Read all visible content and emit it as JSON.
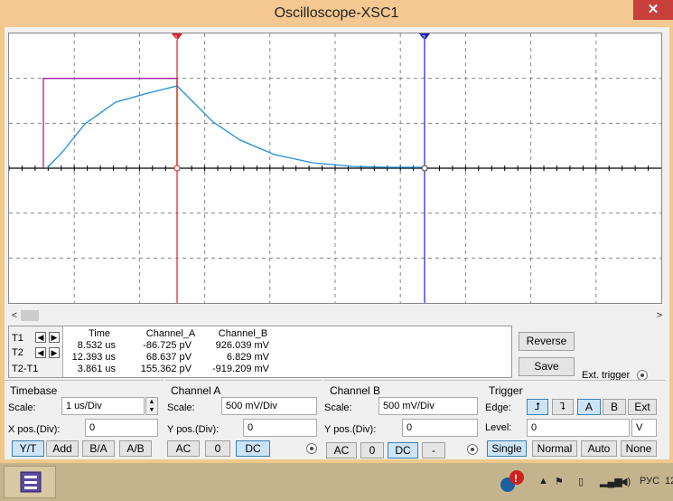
{
  "window": {
    "title": "Oscilloscope-XSC1",
    "close_glyph": "✕"
  },
  "screen": {
    "background": "#ffffff",
    "grid_color": "#888888",
    "channel_a_color": "#1f8fd6",
    "channel_b_color": "#a020a0",
    "cursor1_color": "#e02020",
    "cursor2_color": "#2020c0",
    "cursor1_label": "1",
    "cursor2_label": "2"
  },
  "readout": {
    "headers": [
      "Time",
      "Channel_A",
      "Channel_B"
    ],
    "rows": [
      {
        "label": "T1",
        "time": "8.532 us",
        "a": "-86.725 pV",
        "b": "926.039 mV"
      },
      {
        "label": "T2",
        "time": "12.393 us",
        "a": "68.637 pV",
        "b": "6.829 mV"
      },
      {
        "label": "T2-T1",
        "time": "3.861 us",
        "a": "155.362 pV",
        "b": "-919.209 mV"
      }
    ],
    "arrow_left": "◀",
    "arrow_right": "▶"
  },
  "side_buttons": {
    "reverse": "Reverse",
    "save": "Save",
    "ext_trigger": "Ext. trigger"
  },
  "timebase": {
    "title": "Timebase",
    "scale_label": "Scale:",
    "scale_value": "1 us/Div",
    "xpos_label": "X pos.(Div):",
    "xpos_value": "0",
    "modes": [
      "Y/T",
      "Add",
      "B/A",
      "A/B"
    ],
    "active_mode": "Y/T"
  },
  "channel_a": {
    "title": "Channel A",
    "scale_label": "Scale:",
    "scale_value": "500 mV/Div",
    "ypos_label": "Y pos.(Div):",
    "ypos_value": "0",
    "coupling": [
      "AC",
      "0",
      "DC"
    ],
    "active": "DC"
  },
  "channel_b": {
    "title": "Channel B",
    "scale_label": "Scale:",
    "scale_value": "500 mV/Div",
    "ypos_label": "Y pos.(Div):",
    "ypos_value": "0",
    "coupling": [
      "AC",
      "0",
      "DC",
      "-"
    ],
    "active": "DC"
  },
  "trigger": {
    "title": "Trigger",
    "edge_label": "Edge:",
    "edge_rise": "⮥",
    "edge_fall": "⮧",
    "sources": [
      "A",
      "B",
      "Ext"
    ],
    "active_source": "A",
    "level_label": "Level:",
    "level_value": "0",
    "level_unit": "V",
    "modes": [
      "Single",
      "Normal",
      "Auto",
      "None"
    ],
    "active_mode": "Single"
  },
  "taskbar": {
    "lang": "РУС",
    "clock": "12"
  }
}
